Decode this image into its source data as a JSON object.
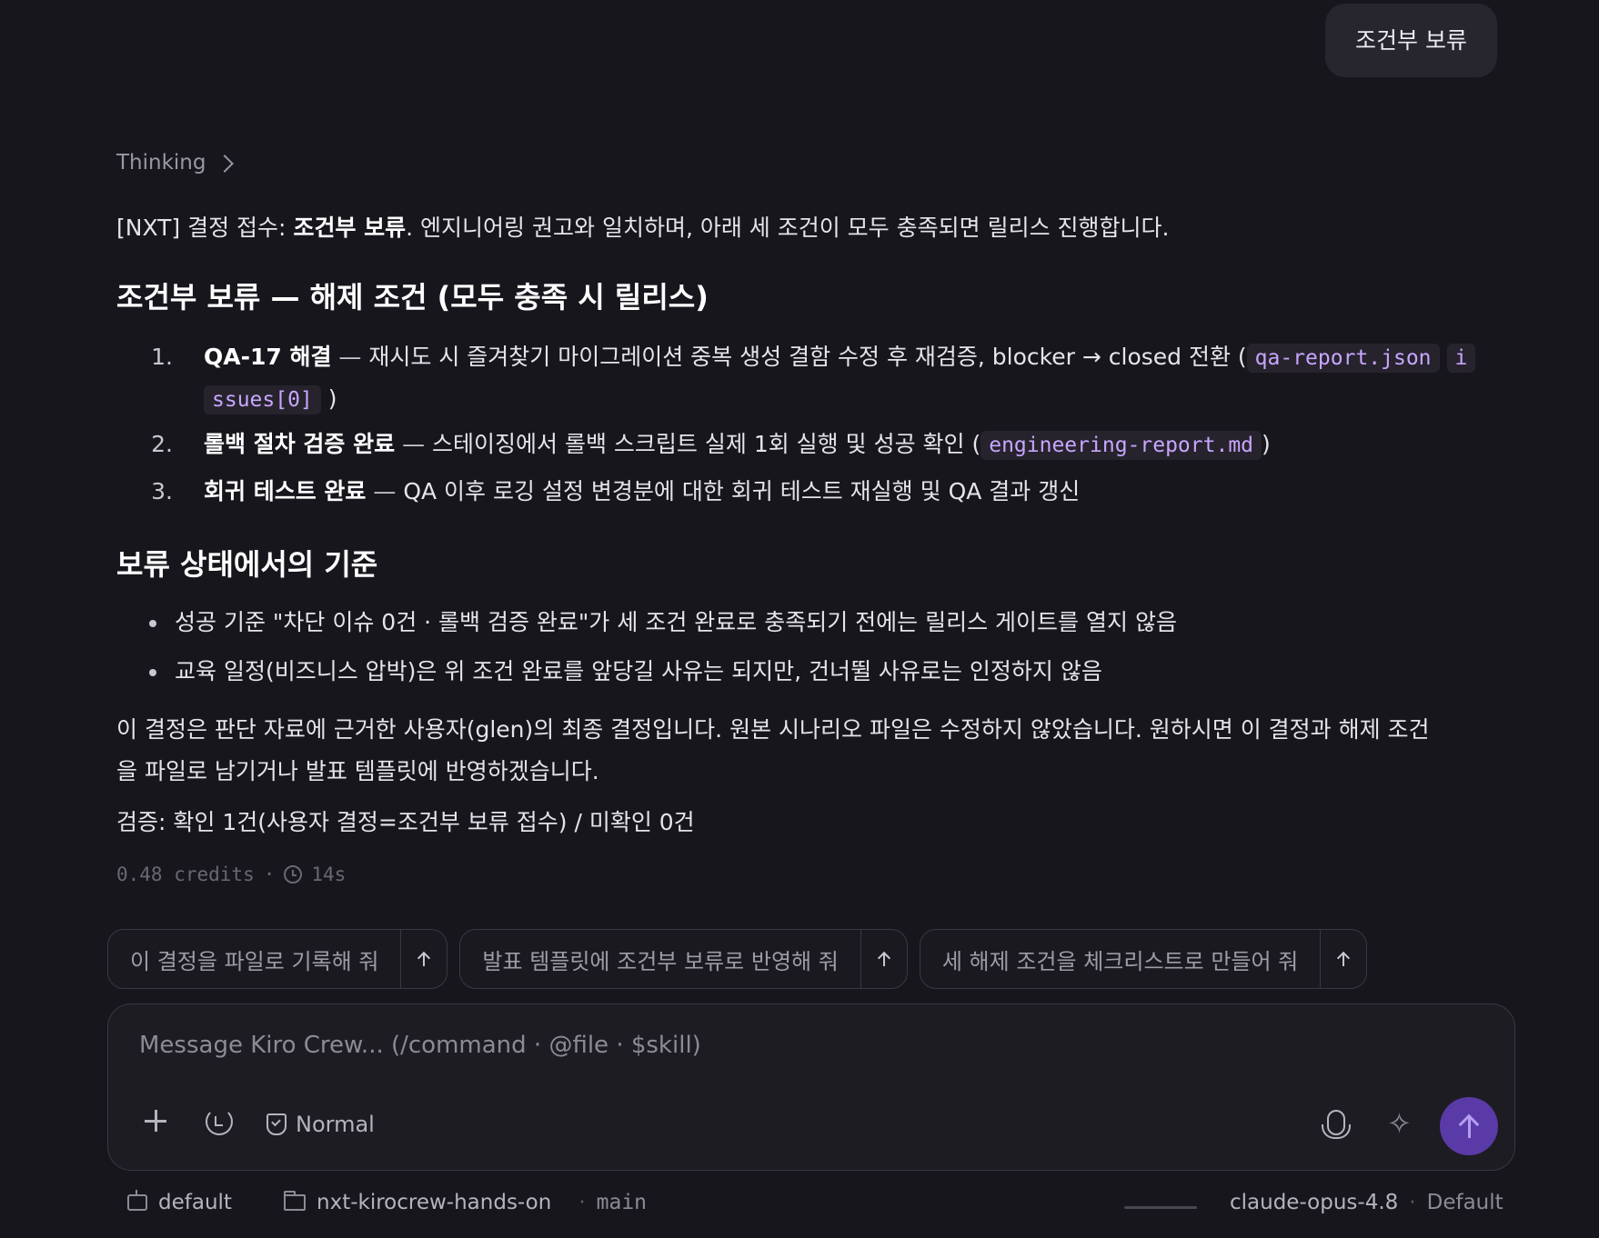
{
  "user_message": "조건부 보류",
  "thinking_label": "Thinking",
  "intro": {
    "prefix": "[NXT] 결정 접수: ",
    "bold": "조건부 보류",
    "suffix": ". 엔지니어링 권고와 일치하며, 아래 세 조건이 모두 충족되면 릴리스 진행합니다."
  },
  "section1_heading": "조건부 보류 — 해제 조건 (모두 충족 시 릴리스)",
  "conditions": [
    {
      "num": "1.",
      "title": "QA-17 해결",
      "dash": " — ",
      "text": "재시도 시 즐겨찾기 마이그레이션 중복 생성 결함 수정 후 재검증, blocker → closed 전환 (",
      "code1": "qa-report.json",
      "code2_line1": "i",
      "code2_line2": "ssues[0]",
      "close": ")"
    },
    {
      "num": "2.",
      "title": "롤백 절차 검증 완료",
      "dash": " — ",
      "text": "스테이징에서 롤백 스크립트 실제 1회 실행 및 성공 확인 (",
      "code1": "engineering-report.md",
      "close": ")"
    },
    {
      "num": "3.",
      "title": "회귀 테스트 완료",
      "dash": " — ",
      "text": "QA 이후 로깅 설정 변경분에 대한 회귀 테스트 재실행 및 QA 결과 갱신"
    }
  ],
  "section2_heading": "보류 상태에서의 기준",
  "criteria": [
    "성공 기준 \"차단 이슈 0건 · 롤백 검증 완료\"가 세 조건 완료로 충족되기 전에는 릴리스 게이트를 열지 않음",
    "교육 일정(비즈니스 압박)은 위 조건 완료를 앞당길 사유는 되지만, 건너뛸 사유로는 인정하지 않음"
  ],
  "closing_line1": "이 결정은 판단 자료에 근거한 사용자(glen)의 최종 결정입니다. 원본 시나리오 파일은 수정하지 않았습니다. 원하시면 이 결정과 해제 조건",
  "closing_line2": "을 파일로 남기거나 발표 템플릿에 반영하겠습니다.",
  "verification": "검증: 확인 1건(사용자 결정=조건부 보류 접수) / 미확인 0건",
  "meta": {
    "credits": "0.48 credits",
    "dot": "·",
    "duration": "14s"
  },
  "suggestions": [
    "이 결정을 파일로 기록해 줘",
    "발표 템플릿에 조건부 보류로 반영해 줘",
    "세 해제 조건을 체크리스트로 만들어 줘"
  ],
  "composer": {
    "placeholder": "Message Kiro Crew... (/command · @file · $skill)",
    "mode_label": "Normal"
  },
  "status_bar": {
    "agent": "default",
    "folder": "nxt-kirocrew-hands-on",
    "dot": "·",
    "branch": "main",
    "context_usage": 0.15,
    "model": "claude-opus-4.8",
    "model_mode": "Default"
  },
  "colors": {
    "background": "#18161d",
    "code_text": "#c8a6ff",
    "send_button": "#5a3aa6",
    "progress": "#7c5cf0"
  }
}
